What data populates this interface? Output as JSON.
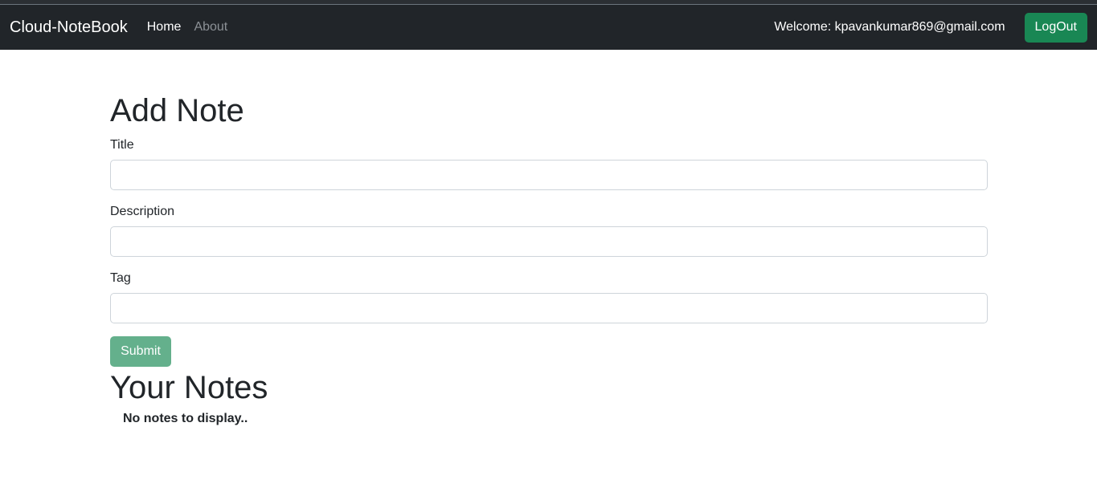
{
  "navbar": {
    "brand": "Cloud-NoteBook",
    "links": [
      "Home",
      "About"
    ],
    "welcome": "Welcome: kpavankumar869@gmail.com",
    "logout_label": "LogOut"
  },
  "add_note": {
    "heading": "Add Note",
    "title_label": "Title",
    "title_value": "",
    "description_label": "Description",
    "description_value": "",
    "tag_label": "Tag",
    "tag_value": "",
    "submit_label": "Submit"
  },
  "notes": {
    "heading": "Your Notes",
    "empty_message": "No notes to display.."
  },
  "colors": {
    "navbar_bg": "#212529",
    "logout_bg": "#198754",
    "submit_bg_disabled": "#64b08c"
  }
}
